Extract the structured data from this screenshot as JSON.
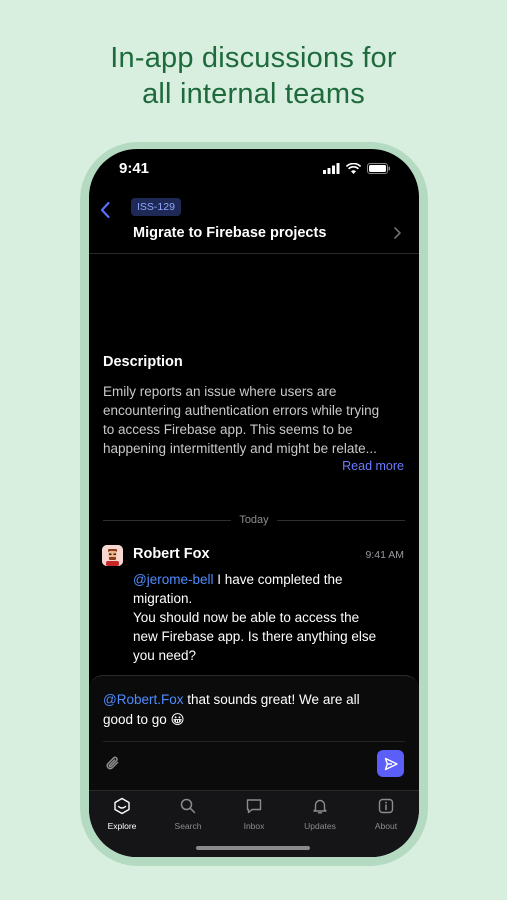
{
  "headline": {
    "line1": "In-app discussions for",
    "line2": "all internal teams"
  },
  "status_bar": {
    "time": "9:41"
  },
  "issue": {
    "badge": "ISS-129",
    "title": "Migrate to Firebase projects"
  },
  "description": {
    "heading": "Description",
    "lines": [
      "Emily reports an issue where users are",
      "encountering authentication errors while trying",
      "to access Firebase app. This seems to be",
      "happening intermittently and might be relate..."
    ],
    "read_more": "Read more"
  },
  "divider": {
    "label": "Today"
  },
  "message": {
    "author": "Robert Fox",
    "time": "9:41 AM",
    "mention": "@jerome-bell",
    "line1_rest": " I have completed the",
    "line2": "migration.",
    "line3": "You should now be able to access the",
    "line4": "new Firebase app. Is there anything else",
    "line5": "you need?"
  },
  "composer": {
    "mention": "@Robert.Fox",
    "line1_rest": " that sounds great! We are all",
    "line2": "good to go 😀"
  },
  "tabs": [
    {
      "label": "Explore",
      "icon": "explore-icon",
      "active": true
    },
    {
      "label": "Search",
      "icon": "search-icon",
      "active": false
    },
    {
      "label": "Inbox",
      "icon": "inbox-icon",
      "active": false
    },
    {
      "label": "Updates",
      "icon": "bell-icon",
      "active": false
    },
    {
      "label": "About",
      "icon": "info-icon",
      "active": false
    }
  ],
  "colors": {
    "background": "#d8efe0",
    "headline": "#1e6a3c",
    "accent": "#5b5ff7",
    "mention": "#4f8cff"
  }
}
